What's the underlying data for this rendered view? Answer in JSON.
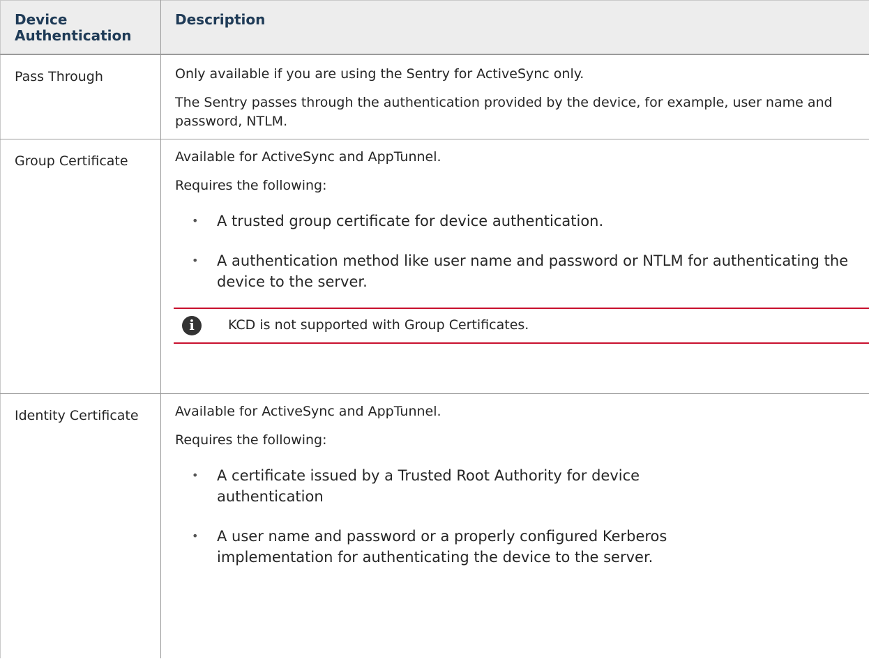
{
  "table": {
    "headers": {
      "col1_line1": "Device",
      "col1_line2": "Authentication",
      "col2": "Description"
    },
    "rows": [
      {
        "name": "Pass Through",
        "paragraphs": [
          "Only available if you are using the Sentry for ActiveSync only.",
          "The Sentry passes through the authentication provided by the device, for example, user name and password, NTLM."
        ]
      },
      {
        "name": "Group Certificate",
        "paragraphs": [
          "Available for ActiveSync and AppTunnel.",
          "Requires the following:"
        ],
        "bullets": [
          "A trusted group certificate for device authentication.",
          "A authentication method like user name and password or NTLM for authenticating the device to the server."
        ],
        "note": "KCD is not supported with Group Certificates."
      },
      {
        "name": "Identity Certificate",
        "paragraphs": [
          "Available for ActiveSync and AppTunnel.",
          "Requires the following:"
        ],
        "bullets": [
          "A certificate issued by a Trusted Root Authority for device authentication",
          "A user name and password or a properly configured Kerberos implementation for authenticating the device to the server."
        ]
      }
    ]
  },
  "icons": {
    "bullet": "•",
    "info": "i"
  },
  "colors": {
    "header_bg": "#ededed",
    "header_text": "#1f3b57",
    "note_border": "#c8102e"
  }
}
